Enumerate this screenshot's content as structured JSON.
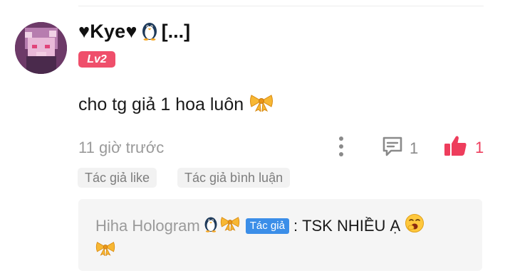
{
  "comment": {
    "username": "♥Kye♥",
    "username_suffix": "[...]",
    "level": "Lv2",
    "text": "cho tg giả 1 hoa luôn",
    "timestamp": "11 giờ trước",
    "reply_count": "1",
    "like_count": "1",
    "tags": [
      "Tác giả like",
      "Tác giả bình luận"
    ]
  },
  "reply": {
    "author": "Hiha Hologram",
    "author_badge": "Tác giả",
    "separator": ":",
    "text": "TSK NHIỀU Ạ"
  },
  "icons": {
    "username_emoji": "penguin-icon",
    "comment_emoji": "ribbon-bow-icon",
    "more": "more-vertical-icon",
    "reply": "comment-bubble-icon",
    "like": "thumbs-up-icon",
    "reply_emojis": [
      "penguin-icon",
      "ribbon-bow-icon",
      "yawning-face-icon",
      "ribbon-bow-icon"
    ]
  },
  "colors": {
    "level_badge": "#ef4f6b",
    "like_accent": "#ee3d5c",
    "author_badge": "#3b8ee8",
    "muted_text": "#9a9a9a",
    "tag_bg": "#f2f2f2",
    "reply_bg": "#f5f5f5"
  }
}
